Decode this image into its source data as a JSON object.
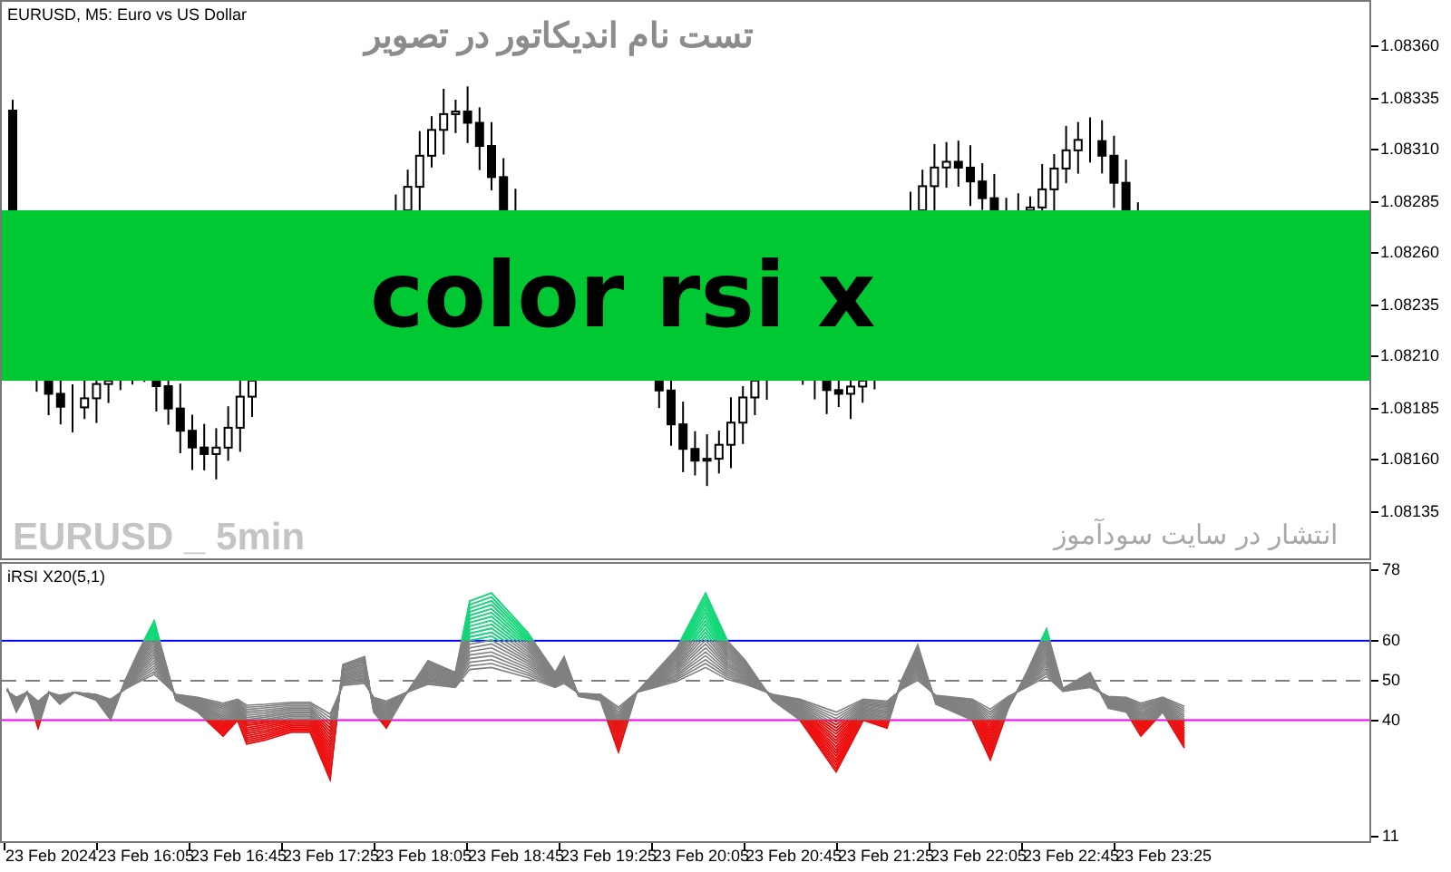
{
  "chart": {
    "symbol_label": "EURUSD, M5:  Euro vs US Dollar",
    "title": "تست نام اندیکاتور در تصویر",
    "banner": "color rsi x",
    "watermark_left": "EURUSD _ 5min",
    "watermark_right": "انتشار در سایت سودآموز",
    "price_ticks": [
      "1.08360",
      "1.08335",
      "1.08310",
      "1.08285",
      "1.08260",
      "1.08235",
      "1.08210",
      "1.08185",
      "1.08160",
      "1.08135"
    ]
  },
  "indicator": {
    "label": "iRSI X20(5,1)",
    "top_tick": "78",
    "bottom_tick": "11",
    "levels": [
      {
        "label": "60",
        "kind": "solid",
        "color": "#0000ff"
      },
      {
        "label": "50",
        "kind": "dashed",
        "color": "#808080"
      },
      {
        "label": "40",
        "kind": "solid",
        "color": "#ff00ff"
      }
    ]
  },
  "time_axis": [
    "23 Feb 2024",
    "23 Feb 16:05",
    "23 Feb 16:45",
    "23 Feb 17:25",
    "23 Feb 18:05",
    "23 Feb 18:45",
    "23 Feb 19:25",
    "23 Feb 20:05",
    "23 Feb 20:45",
    "23 Feb 21:25",
    "23 Feb 22:05",
    "23 Feb 22:45",
    "23 Feb 23:25"
  ]
}
